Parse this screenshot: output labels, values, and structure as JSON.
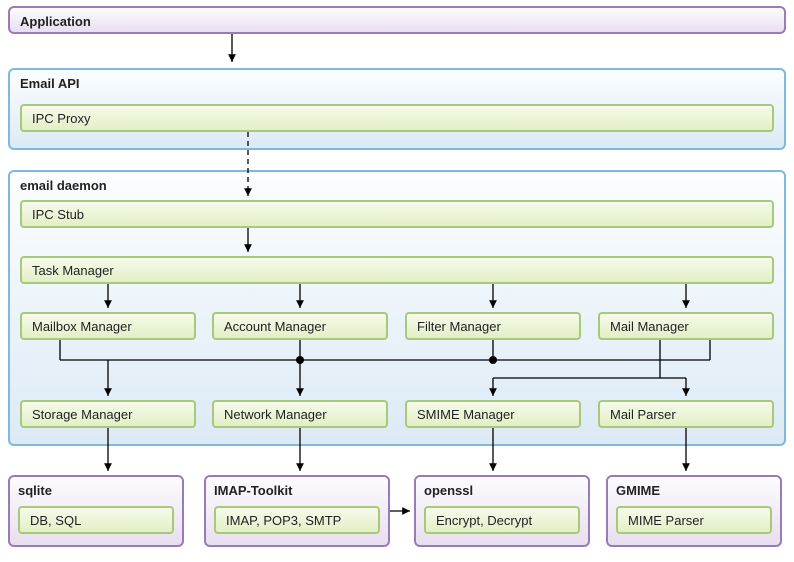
{
  "application": {
    "label": "Application"
  },
  "email_api": {
    "title": "Email API",
    "ipc_proxy": "IPC Proxy"
  },
  "email_daemon": {
    "title": "email daemon",
    "ipc_stub": "IPC Stub",
    "task_manager": "Task Manager",
    "mailbox_manager": "Mailbox Manager",
    "account_manager": "Account Manager",
    "filter_manager": "Filter Manager",
    "mail_manager": "Mail Manager",
    "storage_manager": "Storage Manager",
    "network_manager": "Network Manager",
    "smime_manager": "SMIME Manager",
    "mail_parser": "Mail Parser"
  },
  "libs": {
    "sqlite": {
      "title": "sqlite",
      "inner": "DB, SQL"
    },
    "imap_toolkit": {
      "title": "IMAP-Toolkit",
      "inner": "IMAP, POP3, SMTP"
    },
    "openssl": {
      "title": "openssl",
      "inner": "Encrypt, Decrypt"
    },
    "gmime": {
      "title": "GMIME",
      "inner": "MIME Parser"
    }
  }
}
